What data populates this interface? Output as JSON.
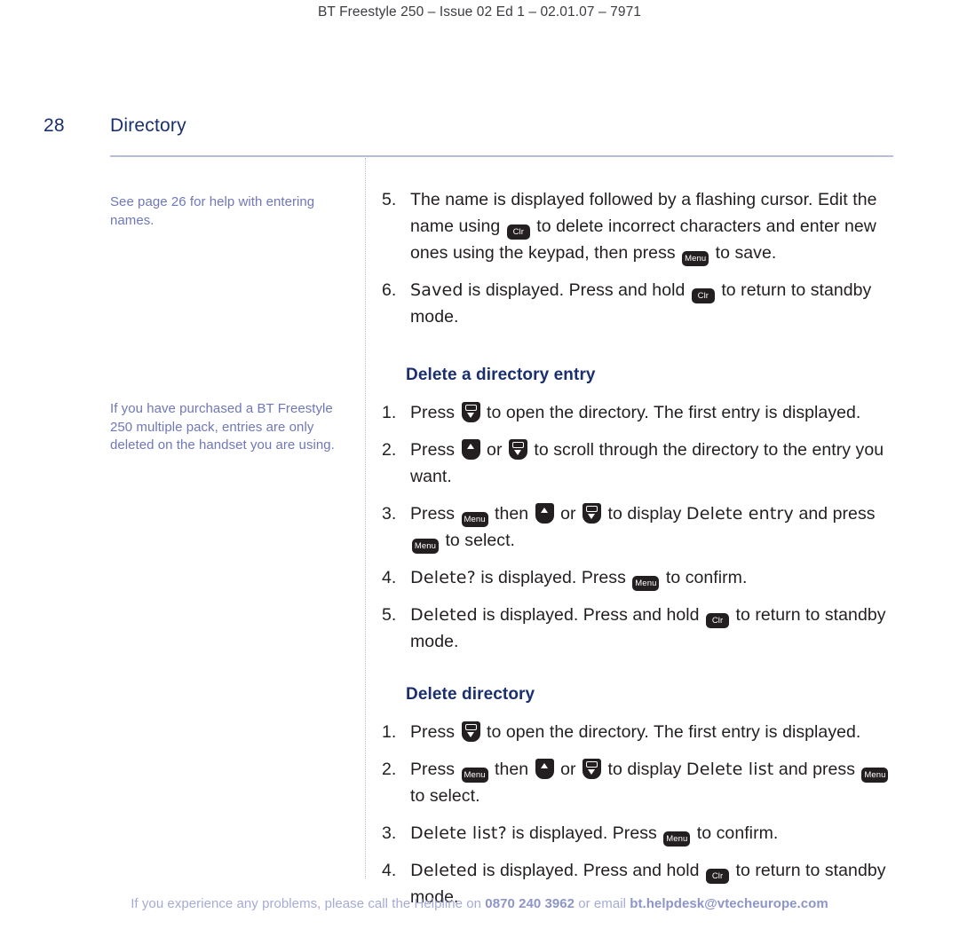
{
  "running_header": "BT Freestyle 250 – Issue 02 Ed 1 – 02.01.07 – 7971",
  "page": {
    "number": "28",
    "section_title": "Directory",
    "accent_color": "#1a2f6e",
    "rule_color": "#b9bcdc",
    "note_color": "#6f78b8",
    "footer_color": "#a5abd6"
  },
  "side_notes": [
    "See page 26 for help with entering names.",
    "If you have purchased a BT Freestyle 250 multiple pack, entries are only deleted on the handset you are using."
  ],
  "keys": {
    "clr": "Clr",
    "menu": "Menu",
    "down": "down-nav-key",
    "up": "up-nav-key"
  },
  "continued_steps": [
    {
      "num": "5.",
      "parts": [
        {
          "t": "text",
          "v": "The name is displayed followed by a flashing cursor. Edit the name using "
        },
        {
          "t": "key",
          "v": "Clr"
        },
        {
          "t": "text",
          "v": " to delete incorrect characters and enter new ones using the keypad, then press "
        },
        {
          "t": "key",
          "v": "Menu"
        },
        {
          "t": "text",
          "v": " to save."
        }
      ]
    },
    {
      "num": "6.",
      "parts": [
        {
          "t": "lcd",
          "v": "Saved"
        },
        {
          "t": "text",
          "v": " is displayed. Press and hold "
        },
        {
          "t": "key",
          "v": "Clr"
        },
        {
          "t": "text",
          "v": " to return to standby mode."
        }
      ]
    }
  ],
  "sections": [
    {
      "heading": "Delete a directory entry",
      "steps": [
        {
          "num": "1.",
          "parts": [
            {
              "t": "text",
              "v": "Press "
            },
            {
              "t": "navdown",
              "v": "down"
            },
            {
              "t": "text",
              "v": " to open the directory. The first entry is displayed."
            }
          ]
        },
        {
          "num": "2.",
          "parts": [
            {
              "t": "text",
              "v": "Press "
            },
            {
              "t": "navup",
              "v": "up"
            },
            {
              "t": "text",
              "v": " or "
            },
            {
              "t": "navdown",
              "v": "down"
            },
            {
              "t": "text",
              "v": " to scroll through the directory to the entry you want."
            }
          ]
        },
        {
          "num": "3.",
          "parts": [
            {
              "t": "text",
              "v": "Press "
            },
            {
              "t": "key",
              "v": "Menu"
            },
            {
              "t": "text",
              "v": " then "
            },
            {
              "t": "navup",
              "v": "up"
            },
            {
              "t": "text",
              "v": " or "
            },
            {
              "t": "navdown",
              "v": "down"
            },
            {
              "t": "text",
              "v": " to display "
            },
            {
              "t": "lcd",
              "v": "Delete entry"
            },
            {
              "t": "text",
              "v": "   and press "
            },
            {
              "t": "key",
              "v": "Menu"
            },
            {
              "t": "text",
              "v": " to select."
            }
          ]
        },
        {
          "num": "4.",
          "parts": [
            {
              "t": "lcd",
              "v": "Delete?"
            },
            {
              "t": "text",
              "v": "   is displayed. Press "
            },
            {
              "t": "key",
              "v": "Menu"
            },
            {
              "t": "text",
              "v": " to confirm."
            }
          ]
        },
        {
          "num": "5.",
          "parts": [
            {
              "t": "lcd",
              "v": "Deleted"
            },
            {
              "t": "text",
              "v": "  is displayed. Press and hold "
            },
            {
              "t": "key",
              "v": "Clr"
            },
            {
              "t": "text",
              "v": " to return to standby mode."
            }
          ]
        }
      ]
    },
    {
      "heading": "Delete directory",
      "steps": [
        {
          "num": "1.",
          "parts": [
            {
              "t": "text",
              "v": "Press "
            },
            {
              "t": "navdown",
              "v": "down"
            },
            {
              "t": "text",
              "v": " to open the directory. The first entry is displayed."
            }
          ]
        },
        {
          "num": "2.",
          "parts": [
            {
              "t": "text",
              "v": "Press "
            },
            {
              "t": "key",
              "v": "Menu"
            },
            {
              "t": "text",
              "v": " then "
            },
            {
              "t": "navup",
              "v": "up"
            },
            {
              "t": "text",
              "v": " or "
            },
            {
              "t": "navdown",
              "v": "down"
            },
            {
              "t": "text",
              "v": " to display "
            },
            {
              "t": "lcd",
              "v": "Delete list"
            },
            {
              "t": "text",
              "v": "   and press "
            },
            {
              "t": "key",
              "v": "Menu"
            },
            {
              "t": "text",
              "v": " to select."
            }
          ]
        },
        {
          "num": "3.",
          "parts": [
            {
              "t": "lcd",
              "v": "Delete list?"
            },
            {
              "t": "text",
              "v": "   is displayed. Press "
            },
            {
              "t": "key",
              "v": "Menu"
            },
            {
              "t": "text",
              "v": " to confirm."
            }
          ]
        },
        {
          "num": "4.",
          "parts": [
            {
              "t": "lcd",
              "v": "Deleted"
            },
            {
              "t": "text",
              "v": "  is displayed. Press and hold "
            },
            {
              "t": "key",
              "v": "Clr"
            },
            {
              "t": "text",
              "v": " to return to standby mode."
            }
          ]
        }
      ]
    }
  ],
  "footer": {
    "lead": "If you experience any problems, please call the Helpline on ",
    "phone": "0870 240 3962",
    "mid": " or email ",
    "email": "bt.helpdesk@vtecheurope.com"
  }
}
